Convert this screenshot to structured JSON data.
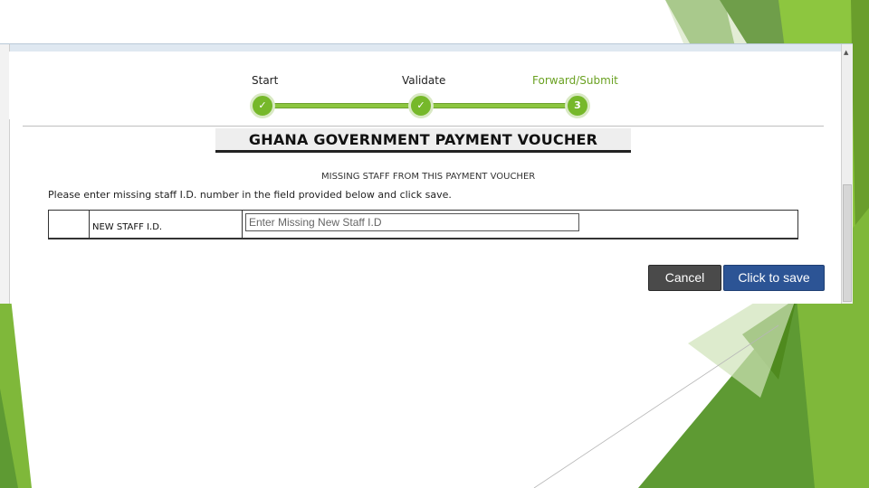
{
  "wizard": {
    "steps": [
      {
        "label": "Start",
        "state": "complete",
        "icon": "checkmark-icon"
      },
      {
        "label": "Validate",
        "state": "complete",
        "icon": "checkmark-icon"
      },
      {
        "label": "Forward/Submit",
        "state": "current",
        "number": "3"
      }
    ]
  },
  "voucher": {
    "title": "GHANA GOVERNMENT PAYMENT VOUCHER",
    "subtitle": "MISSING STAFF FROM THIS PAYMENT VOUCHER",
    "instruction": "Please enter missing staff I.D. number in the field provided below and click save."
  },
  "form": {
    "field_label": "NEW STAFF I.D.",
    "input_value": "",
    "input_placeholder": "Enter Missing New Staff I.D"
  },
  "actions": {
    "cancel_label": "Cancel",
    "save_label": "Click to save"
  },
  "colors": {
    "accent_green": "#76b82a",
    "active_step_text": "#6aa121",
    "save_button": "#2c5495",
    "cancel_button": "#4a4a4a"
  }
}
